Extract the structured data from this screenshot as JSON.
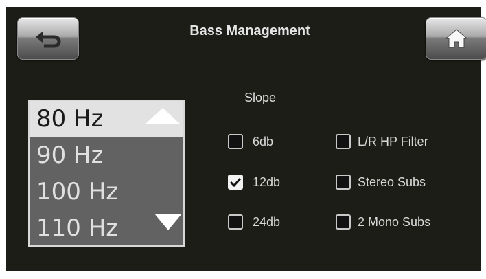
{
  "header": {
    "title": "Bass Management"
  },
  "frequency_list": {
    "items": [
      {
        "label": "80 Hz",
        "selected": true
      },
      {
        "label": "90 Hz",
        "selected": false
      },
      {
        "label": "100 Hz",
        "selected": false
      },
      {
        "label": "110 Hz",
        "selected": false
      }
    ]
  },
  "slope": {
    "label": "Slope",
    "options": [
      {
        "label": "6db",
        "checked": false
      },
      {
        "label": "12db",
        "checked": true
      },
      {
        "label": "24db",
        "checked": false
      }
    ]
  },
  "toggles": [
    {
      "label": "L/R HP Filter",
      "checked": false
    },
    {
      "label": "Stereo Subs",
      "checked": false
    },
    {
      "label": "2 Mono Subs",
      "checked": false
    }
  ],
  "icons": {
    "back": "back-arrow-icon",
    "home": "home-icon",
    "up": "scroll-up-icon",
    "down": "scroll-down-icon",
    "check": "checkmark-icon"
  },
  "colors": {
    "background": "#1c1d17",
    "list_bg": "#626262",
    "selected_bg": "#e2e2e2",
    "text": "#e0e0e0"
  }
}
